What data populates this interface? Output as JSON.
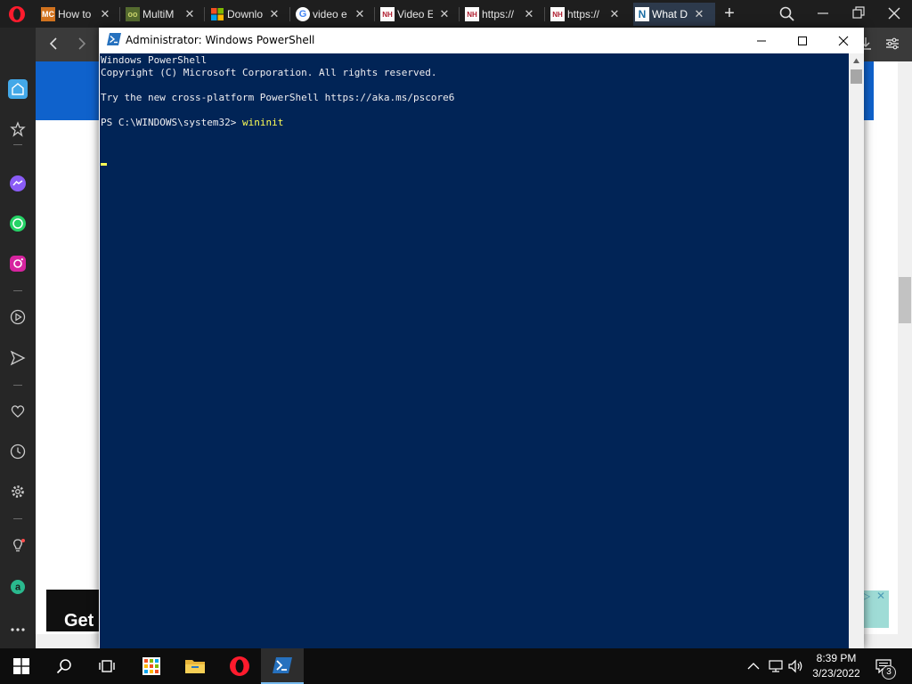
{
  "browser": {
    "tabs": [
      {
        "title": "How to",
        "favicon_text": "MC",
        "favicon_color": "#d1721e"
      },
      {
        "title": "MultiM",
        "favicon_text": "oo",
        "favicon_color": "#556b2f"
      },
      {
        "title": "Downlo",
        "favicon_text": "",
        "favicon_color": "#0078d4"
      },
      {
        "title": "video e",
        "favicon_text": "G",
        "favicon_color": "#ffffff"
      },
      {
        "title": "Video E",
        "favicon_text": "NH",
        "favicon_color": "#b01e2f"
      },
      {
        "title": "https://",
        "favicon_text": "NH",
        "favicon_color": "#b01e2f"
      },
      {
        "title": "https://",
        "favicon_text": "NH",
        "favicon_color": "#b01e2f"
      },
      {
        "title": "What D",
        "favicon_text": "N",
        "favicon_color": "#1c6ea4"
      }
    ],
    "new_tab_label": "+"
  },
  "webpage": {
    "ad_text": "Get",
    "ad_badge": "▷"
  },
  "powershell": {
    "title": "Administrator: Windows PowerShell",
    "lines": [
      "Windows PowerShell",
      "Copyright (C) Microsoft Corporation. All rights reserved.",
      "",
      "Try the new cross-platform PowerShell https://aka.ms/pscore6",
      ""
    ],
    "prompt": "PS C:\\WINDOWS\\system32> ",
    "command": "wininit",
    "console_bg": "#012456",
    "command_color": "#ffff55"
  },
  "taskbar": {
    "time": "8:39 PM",
    "date": "3/23/2022",
    "notification_count": "3"
  }
}
